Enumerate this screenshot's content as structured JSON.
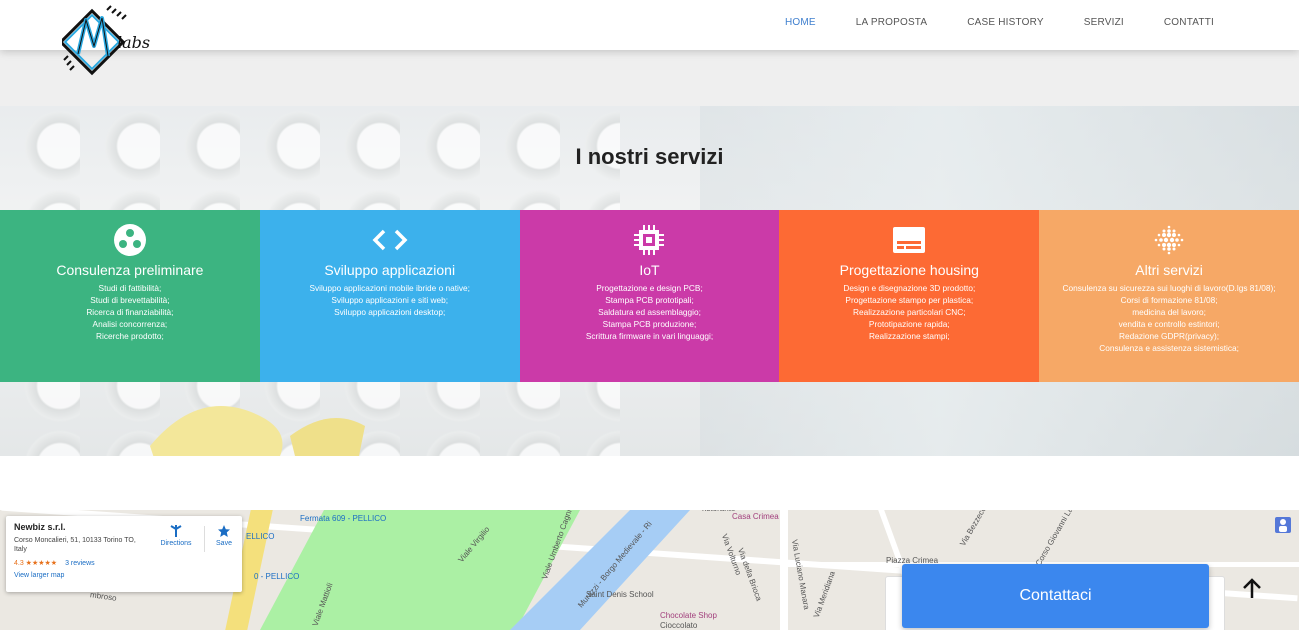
{
  "nav": {
    "items": [
      "HOME",
      "LA PROPOSTA",
      "CASE HISTORY",
      "SERVIZI",
      "CONTATTI"
    ]
  },
  "hero": {
    "title": "I nostri servizi"
  },
  "services": [
    {
      "color": "#3cb481",
      "icon": "bubbles-icon",
      "title": "Consulenza preliminare",
      "items": [
        "Studi di fattibilità;",
        "Studi di brevettabilità;",
        "Ricerca di finanziabilità;",
        "Analisi concorrenza;",
        "Ricerche prodotto;"
      ]
    },
    {
      "color": "#3cb1ec",
      "icon": "code-icon",
      "title": "Sviluppo applicazioni",
      "items": [
        "Sviluppo applicazioni mobile ibride o native;",
        "Sviluppo applicazioni e siti web;",
        "Sviluppo applicazioni desktop;"
      ]
    },
    {
      "color": "#cb3aa8",
      "icon": "chip-icon",
      "title": "IoT",
      "items": [
        "Progettazione e design PCB;",
        "Stampa PCB prototipali;",
        "Saldatura ed assemblaggio;",
        "Stampa PCB produzione;",
        "Scrittura firmware in vari linguaggi;"
      ]
    },
    {
      "color": "#fd6a34",
      "icon": "card-icon",
      "title": "Progettazione housing",
      "items": [
        "Design e disegnazione 3D prodotto;",
        "Progettazione stampo per plastica;",
        "Realizzazione particolari CNC;",
        "Prototipazione rapida;",
        "Realizzazione stampi;"
      ]
    },
    {
      "color": "#f6a866",
      "icon": "dots-grid-icon",
      "title": "Altri servizi",
      "items": [
        "Consulenza su sicurezza sui luoghi di lavoro(D.lgs 81/08);",
        "Corsi di formazione 81/08;",
        "medicina del lavoro;",
        "vendita e controllo estintori;",
        "Redazione GDPR(privacy);",
        "Consulenza e assistenza sistemistica;"
      ]
    }
  ],
  "map": {
    "labels": {
      "fermata": "Fermata 609 - PELLICO",
      "pellico1": "ELLICO",
      "pellico2": "0 - PELLICO",
      "viale_virgilio": "Viale Virgilio",
      "viale_mattioli": "Viale Mattioli",
      "umberto": "Viale Umberto Cagni",
      "murazzi": "Murazzi - Borgo Medievale - Ri",
      "school": "Saint Denis School",
      "choc": "Chocolate Shop",
      "choc2": "Cioccolato",
      "via_volturno": "Via Volturno",
      "via_brioca": "Via della Brioca",
      "via_mazzini": "Via Luciano Manara",
      "piazza": "Piazza Crimea",
      "via_bezzecca": "Via Bezzecca",
      "via_meridiana": "Via Meridiana",
      "giovanni": "Corso Giovanni Lan",
      "casa_crimea": "Casa Crimea",
      "ristorante": "ristorante",
      "lombroso": "mbroso"
    },
    "card": {
      "name": "Newbiz s.r.l.",
      "address": "Corso Moncalieri, 51, 10133 Torino TO, Italy",
      "rating": "4.3 ★★★★★",
      "reviews": "3 reviews",
      "larger": "View larger map",
      "directions": "Directions",
      "save": "Save"
    }
  },
  "cta": {
    "contact": "Contattaci"
  }
}
